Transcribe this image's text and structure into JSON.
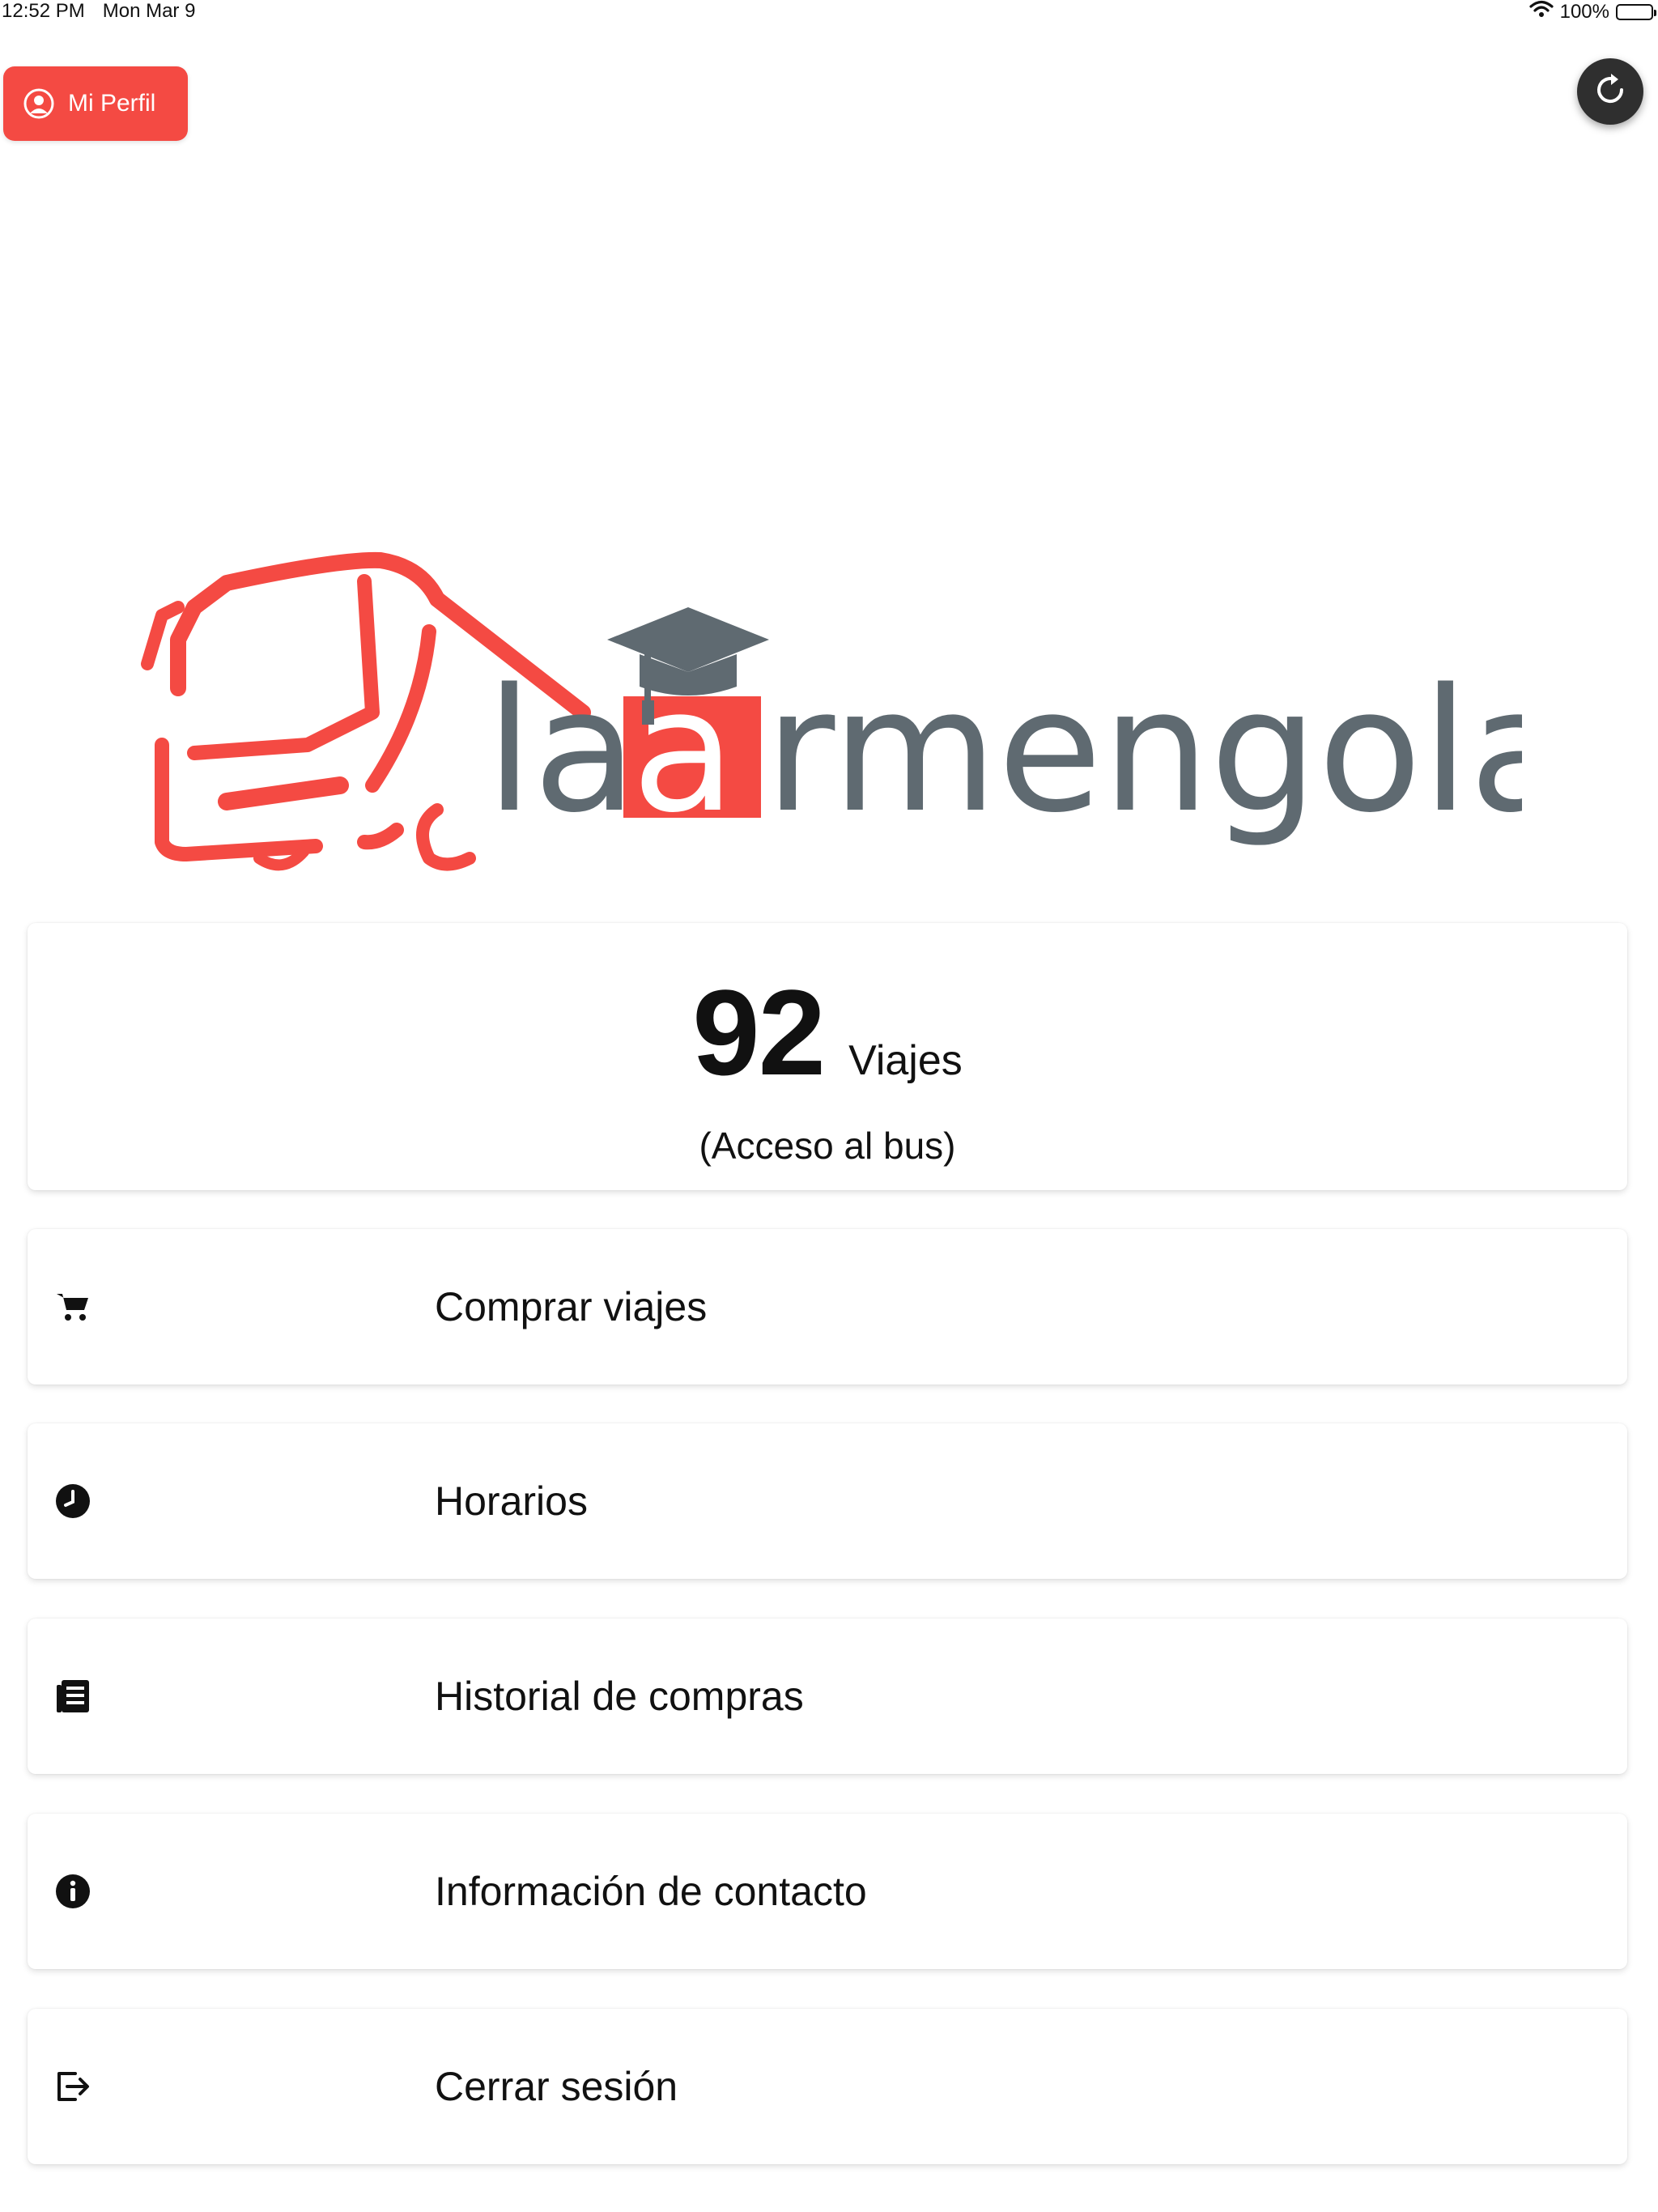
{
  "status_bar": {
    "time": "12:52 PM",
    "date": "Mon Mar 9",
    "battery": "100%"
  },
  "header": {
    "profile_label": "Mi Perfil",
    "refresh_icon": "refresh-icon"
  },
  "logo": {
    "text_left": "la",
    "text_highlight": "a",
    "text_right": "rmengola",
    "brand_red": "#f44a43",
    "brand_gray": "#5f6a71"
  },
  "trips": {
    "count": "92",
    "unit": "Viajes",
    "subtitle": "(Acceso al bus)"
  },
  "menu": [
    {
      "label": "Comprar viajes",
      "icon": "cart-icon"
    },
    {
      "label": "Horarios",
      "icon": "clock-icon"
    },
    {
      "label": "Historial de compras",
      "icon": "list-icon"
    },
    {
      "label": "Información de contacto",
      "icon": "info-icon"
    },
    {
      "label": "Cerrar sesión",
      "icon": "logout-icon"
    }
  ]
}
